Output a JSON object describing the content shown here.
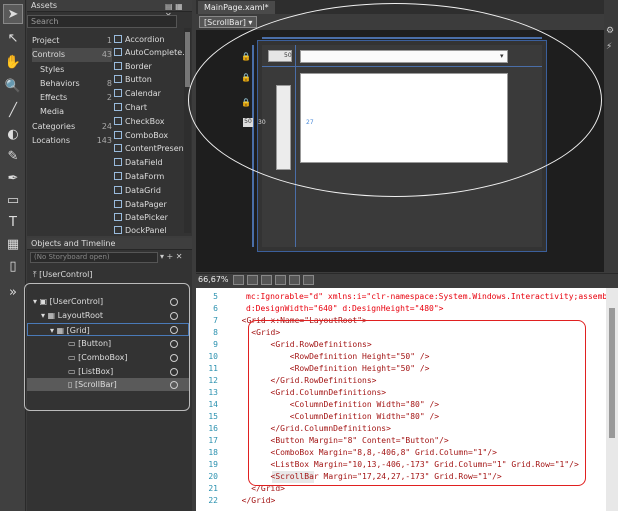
{
  "assets_panel": {
    "title": "Assets",
    "search_placeholder": "Search",
    "categories": [
      {
        "label": "Project",
        "count": "1"
      },
      {
        "label": "Controls",
        "count": "43"
      },
      {
        "label": "Styles",
        "count": ""
      },
      {
        "label": "Behaviors",
        "count": "8"
      },
      {
        "label": "Effects",
        "count": "2"
      },
      {
        "label": "Media",
        "count": ""
      },
      {
        "label": "Categories",
        "count": "24"
      },
      {
        "label": "Locations",
        "count": "143"
      }
    ],
    "items": [
      "Accordion",
      "AutoComplete...",
      "Border",
      "Button",
      "Calendar",
      "Chart",
      "CheckBox",
      "ComboBox",
      "ContentPresen...",
      "DataField",
      "DataForm",
      "DataGrid",
      "DataPager",
      "DatePicker",
      "DockPanel"
    ]
  },
  "objects_panel": {
    "title": "Objects and Timeline",
    "storyboard": "(No Storyboard open)",
    "root": "[UserControl]",
    "tree": [
      "[UserControl]",
      "LayoutRoot",
      "[Grid]",
      "[Button]",
      "[ComboBox]",
      "[ListBox]",
      "[ScrollBar]"
    ]
  },
  "document": {
    "tab": "MainPage.xaml*",
    "breadcrumb": "[ScrollBar] ▾",
    "zoom": "66,67%",
    "cell_labels": {
      "top_value": "50",
      "left_value": "50",
      "mid_a": "30",
      "mid_b": "27"
    }
  },
  "code": {
    "pre_lines": [
      "mc:Ignorable=\"d\" xmlns:i=\"clr-namespace:System.Windows.Interactivity;assemb",
      "d:DesignWidth=\"640\" d:DesignHeight=\"480\">"
    ],
    "lines": [
      {
        "n": "7",
        "text": "  <Grid x:Name=\"LayoutRoot\">"
      },
      {
        "n": "8",
        "text": "    <Grid>"
      },
      {
        "n": "9",
        "text": "        <Grid.RowDefinitions>"
      },
      {
        "n": "10",
        "text": "            <RowDefinition Height=\"50\" />"
      },
      {
        "n": "11",
        "text": "            <RowDefinition Height=\"50\" />"
      },
      {
        "n": "12",
        "text": "        </Grid.RowDefinitions>"
      },
      {
        "n": "13",
        "text": "        <Grid.ColumnDefinitions>"
      },
      {
        "n": "14",
        "text": "            <ColumnDefinition Width=\"80\" />"
      },
      {
        "n": "15",
        "text": "            <ColumnDefinition Width=\"80\" />"
      },
      {
        "n": "16",
        "text": "        </Grid.ColumnDefinitions>"
      },
      {
        "n": "17",
        "text": "        <Button Margin=\"8\" Content=\"Button\"/>"
      },
      {
        "n": "18",
        "text": "        <ComboBox Margin=\"8,8,-406,8\" Grid.Column=\"1\"/>"
      },
      {
        "n": "19",
        "text": "        <ListBox Margin=\"10,13,-406,-173\" Grid.Column=\"1\" Grid.Row=\"1\"/>"
      },
      {
        "n": "20",
        "text": "        <ScrollBar Margin=\"17,24,27,-173\" Grid.Row=\"1\"/>"
      },
      {
        "n": "21",
        "text": "    </Grid>"
      },
      {
        "n": "22",
        "text": "  </Grid>"
      }
    ],
    "pre_numbers": [
      "5",
      "6"
    ]
  }
}
